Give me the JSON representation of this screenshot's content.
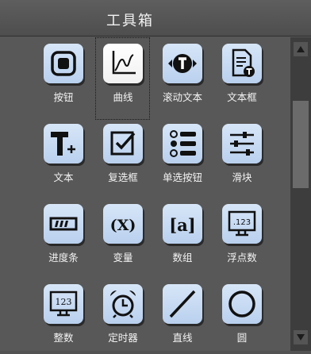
{
  "window": {
    "title": "工具箱"
  },
  "tools": [
    {
      "label": "按钮",
      "icon": "button-icon"
    },
    {
      "label": "曲线",
      "icon": "curve-icon",
      "selected": true
    },
    {
      "label": "滚动文本",
      "icon": "scroll-text-icon"
    },
    {
      "label": "文本框",
      "icon": "text-box-icon"
    },
    {
      "label": "文本",
      "icon": "text-icon"
    },
    {
      "label": "复选框",
      "icon": "checkbox-icon"
    },
    {
      "label": "单选按钮",
      "icon": "radio-button-icon"
    },
    {
      "label": "滑块",
      "icon": "slider-icon"
    },
    {
      "label": "进度条",
      "icon": "progress-bar-icon"
    },
    {
      "label": "变量",
      "icon": "variable-icon"
    },
    {
      "label": "数组",
      "icon": "array-icon"
    },
    {
      "label": "浮点数",
      "icon": "float-icon"
    },
    {
      "label": "整数",
      "icon": "integer-icon"
    },
    {
      "label": "定时器",
      "icon": "timer-icon"
    },
    {
      "label": "直线",
      "icon": "line-icon"
    },
    {
      "label": "圆",
      "icon": "circle-icon"
    }
  ],
  "icon_text": {
    "float": ".123",
    "integer": "123",
    "array": "[a]",
    "variable": "(X)"
  },
  "colors": {
    "background": "#585858",
    "button": "#c4d9f2",
    "selected_button": "#ffffff",
    "label": "#f3f3f3"
  }
}
